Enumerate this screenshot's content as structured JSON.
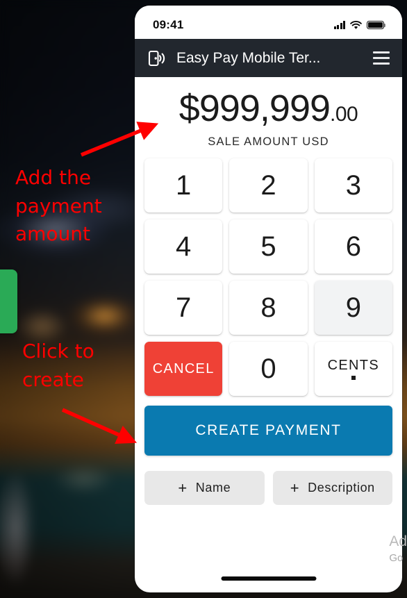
{
  "phone": {
    "status_bar": {
      "time": "09:41",
      "signal_icon": "cellular-signal-icon",
      "wifi_icon": "wifi-icon",
      "battery_icon": "battery-full-icon"
    },
    "app_bar": {
      "app_icon": "contactless-phone-icon",
      "title": "Easy Pay Mobile Ter...",
      "menu_icon": "hamburger-menu-icon"
    },
    "amount_display": {
      "currency_symbol": "$",
      "whole": "999,999",
      "decimal": ".00",
      "full": "$999,999.00",
      "label": "SALE AMOUNT USD"
    },
    "keypad": [
      {
        "label": "1",
        "type": "digit",
        "pressed": false
      },
      {
        "label": "2",
        "type": "digit",
        "pressed": false
      },
      {
        "label": "3",
        "type": "digit",
        "pressed": false
      },
      {
        "label": "4",
        "type": "digit",
        "pressed": false
      },
      {
        "label": "5",
        "type": "digit",
        "pressed": false
      },
      {
        "label": "6",
        "type": "digit",
        "pressed": false
      },
      {
        "label": "7",
        "type": "digit",
        "pressed": false
      },
      {
        "label": "8",
        "type": "digit",
        "pressed": false
      },
      {
        "label": "9",
        "type": "digit",
        "pressed": true
      },
      {
        "label": "CANCEL",
        "type": "cancel",
        "pressed": false
      },
      {
        "label": "0",
        "type": "digit",
        "pressed": false
      },
      {
        "label": "CENTS",
        "type": "cents",
        "pressed": false
      }
    ],
    "create_button": {
      "label": "CREATE PAYMENT"
    },
    "extras": [
      {
        "plus": "+",
        "label": "Name"
      },
      {
        "plus": "+",
        "label": "Description"
      }
    ],
    "home_indicator": "home-indicator"
  },
  "annotations": [
    {
      "text": "Add the\npayment\namount",
      "target": "amount-display"
    },
    {
      "text": "Click to\ncreate",
      "target": "create-payment-button"
    }
  ],
  "watermark": {
    "line1": "Ad",
    "line2": "Go"
  },
  "colors": {
    "app_bar": "#22272e",
    "cancel": "#ef4136",
    "create": "#0a7ab0",
    "pill": "#e8e8e8",
    "annotation": "#ff0000",
    "green_card": "#2aaa56"
  }
}
